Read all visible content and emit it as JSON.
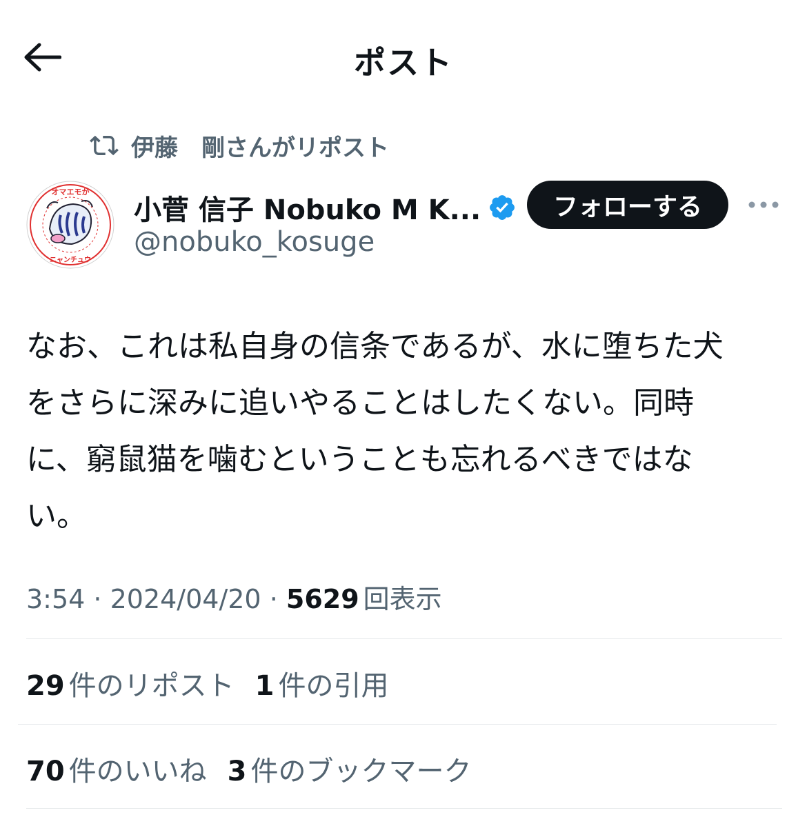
{
  "header": {
    "title": "ポスト"
  },
  "repost_context": {
    "text": "伊藤　剛さんがリポスト"
  },
  "author": {
    "display_name": "小菅 信子 Nobuko M K...",
    "handle": "@nobuko_kosuge",
    "verified": true,
    "avatar_text": "オマエモか ニャンチュウ"
  },
  "follow_button": {
    "label": "フォローする"
  },
  "tweet": {
    "text": "なお、これは私自身の信条であるが、水に堕ちた犬\nをさらに深みに追いやることはしたくない。同時\nに、窮鼠猫を噛むということも忘れるべきではな\nい。"
  },
  "meta": {
    "time": "3:54",
    "separator1": " · ",
    "date": "2024/04/20",
    "separator2": " · ",
    "views_count": "5629",
    "views_label": "回表示"
  },
  "stats": {
    "reposts_count": "29",
    "reposts_label": "件のリポスト",
    "quotes_count": "1",
    "quotes_label": "件の引用",
    "likes_count": "70",
    "likes_label": "件のいいね",
    "bookmarks_count": "3",
    "bookmarks_label": "件のブックマーク"
  },
  "colors": {
    "text": "#0f1419",
    "secondary": "#536471",
    "verified": "#1d9bf0",
    "divider": "#e6e9eb"
  },
  "icons": [
    "back-arrow-icon",
    "repost-icon",
    "verified-badge-icon",
    "more-icon"
  ]
}
